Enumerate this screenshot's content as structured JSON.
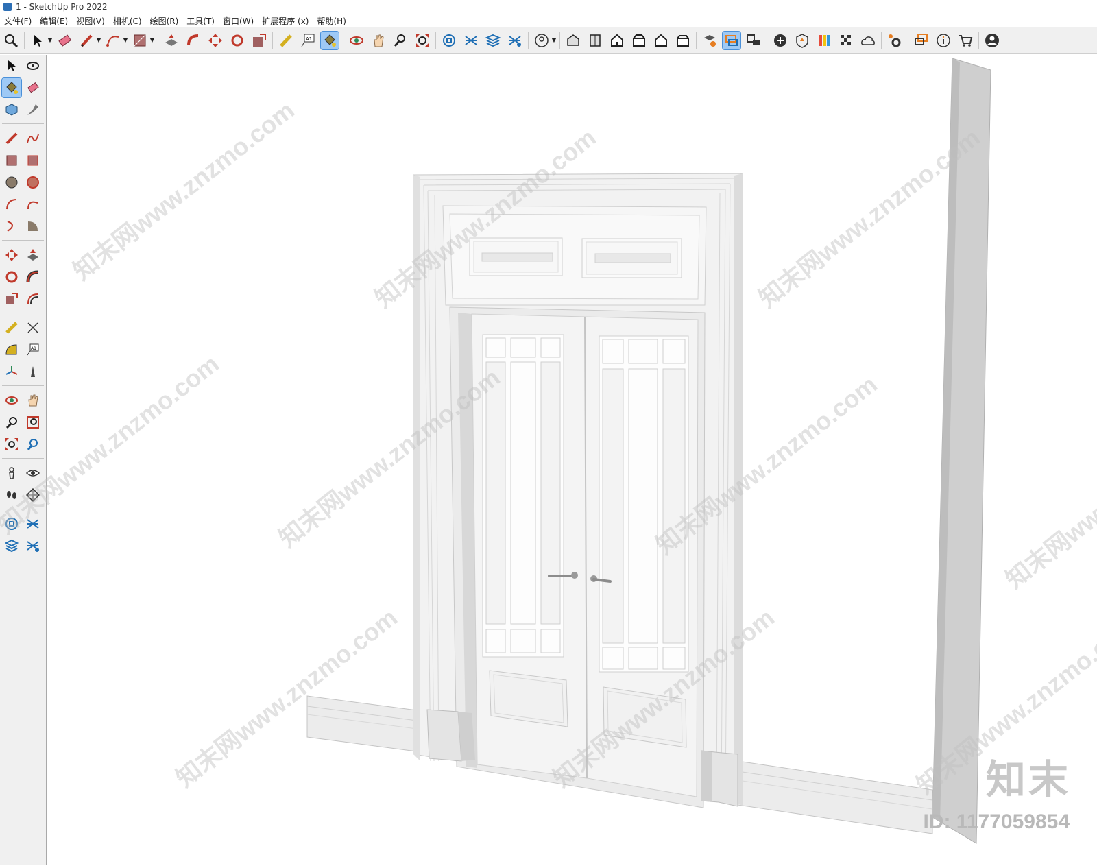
{
  "window": {
    "title": "1 - SketchUp Pro 2022"
  },
  "menu": [
    "文件(F)",
    "编辑(E)",
    "视图(V)",
    "相机(C)",
    "绘图(R)",
    "工具(T)",
    "窗口(W)",
    "扩展程序 (x)",
    "帮助(H)"
  ],
  "toolbar_icons": [
    "zoom-icon",
    "select-icon",
    "eraser-icon",
    "pencil-icon",
    "arc-icon",
    "rectangle-icon",
    "push-pull-icon",
    "follow-me-icon",
    "move-icon",
    "rotate-icon",
    "scale-icon",
    "tape-measure-icon",
    "text-icon",
    "paint-bucket-icon",
    "orbit-icon",
    "pan-icon",
    "zoom-window-icon",
    "zoom-extents-icon",
    "warehouse-icon",
    "extension-warehouse-icon",
    "layout-icon",
    "extension-manager-icon",
    "account-icon",
    "iso-view-icon",
    "top-view-icon",
    "front-view-icon",
    "right-view-icon",
    "back-view-icon",
    "left-view-icon",
    "section-plane-icon",
    "display-section-icon",
    "section-cuts-icon",
    "add-location-icon",
    "shadow-icon",
    "styles-icon",
    "texture-icon",
    "cloud-icon",
    "settings-icon",
    "speech-icon",
    "info-icon",
    "cart-icon",
    "user-icon"
  ],
  "left_toolbar_icons": [
    "select-icon",
    "orbit-icon",
    "paint-bucket-icon",
    "eraser-icon",
    "component-icon",
    "tag-icon",
    "pencil-icon",
    "freehand-icon",
    "rectangle-icon",
    "rotated-rectangle-icon",
    "circle-icon",
    "polygon-icon",
    "arc-icon",
    "2pt-arc-icon",
    "3pt-arc-icon",
    "pie-icon",
    "move-icon",
    "push-pull-icon",
    "rotate-icon",
    "follow-me-icon",
    "scale-icon",
    "offset-icon",
    "tape-measure-icon",
    "dimension-icon",
    "protractor-icon",
    "text-icon",
    "axes-icon",
    "3d-text-icon",
    "orbit-icon",
    "pan-icon",
    "zoom-icon",
    "zoom-window-icon",
    "zoom-extents-icon",
    "previous-view-icon",
    "position-camera-icon",
    "look-around-icon",
    "walk-icon",
    "section-plane-icon",
    "warehouse-icon",
    "extension-warehouse-icon",
    "layout-icon",
    "extension-manager-icon"
  ],
  "watermark": {
    "text": "知末网www.znzmo.com",
    "logo": "知末",
    "id_label": "ID: 1177059854"
  }
}
